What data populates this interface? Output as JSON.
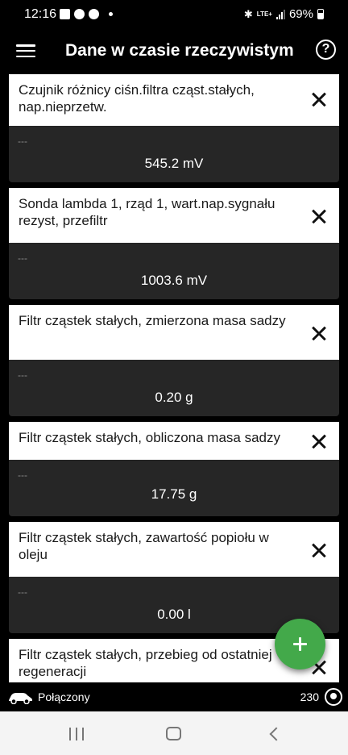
{
  "status_bar": {
    "time": "12:16",
    "network": "LTE+",
    "battery": "69%",
    "icons": [
      "gallery-icon",
      "facebook-icon",
      "messenger-icon",
      "notification-dot-icon",
      "bluetooth-icon",
      "lte-icon",
      "signal-icon",
      "battery-icon"
    ]
  },
  "app_bar": {
    "title": "Dane w czasie rzeczywistym",
    "menu_icon": "hamburger-menu-icon",
    "help_icon_glyph": "?"
  },
  "cards": [
    {
      "title": "Czujnik różnicy ciśn.filtra cząst.stałych, nap.nieprzetw.",
      "placeholder": "---",
      "value": "545.2 mV"
    },
    {
      "title": "Sonda lambda 1, rząd 1, wart.nap.sygnału rezyst, przefiltr",
      "placeholder": "---",
      "value": "1003.6 mV"
    },
    {
      "title": "Filtr cząstek stałych, zmierzona masa sadzy",
      "placeholder": "---",
      "value": "0.20 g"
    },
    {
      "title": "Filtr cząstek stałych, obliczona masa sadzy",
      "placeholder": "---",
      "value": "17.75 g"
    },
    {
      "title": "Filtr cząstek stałych, zawartość popiołu w oleju",
      "placeholder": "---",
      "value": "0.00 l"
    },
    {
      "title": "Filtr cząstek stałych, przebieg od ostatniej regeneracji",
      "placeholder": "---",
      "value": ""
    }
  ],
  "fab": {
    "icon": "plus-icon"
  },
  "connection_bar": {
    "status": "Połączony",
    "counter": "230",
    "car_icon": "car-icon",
    "gauge_icon": "gauge-icon"
  },
  "nav_bar": {
    "icons": [
      "recents-icon",
      "home-icon",
      "back-icon"
    ]
  },
  "colors": {
    "background": "#000000",
    "card_header": "#ffffff",
    "card_body": "#262626",
    "fab": "#43a94a",
    "nav_bar": "#f4f4f4"
  }
}
